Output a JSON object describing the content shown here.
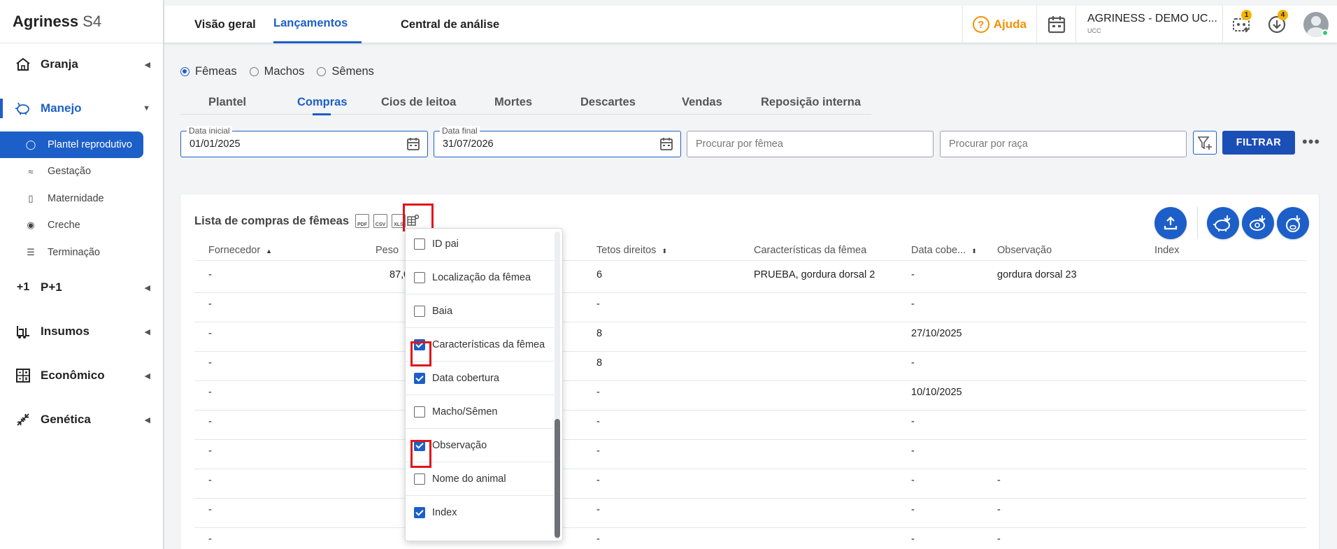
{
  "brand": {
    "name": "Agriness",
    "version": "S4"
  },
  "sidebar": {
    "groups": [
      {
        "label": "Granja",
        "icon": "home-icon"
      },
      {
        "label": "Manejo",
        "icon": "pig-icon"
      },
      {
        "label": "P+1",
        "icon": "plus-one-icon"
      },
      {
        "label": "Insumos",
        "icon": "forklift-icon"
      },
      {
        "label": "Econômico",
        "icon": "calculator-icon"
      },
      {
        "label": "Genética",
        "icon": "dna-icon"
      }
    ],
    "manejo_items": [
      {
        "label": "Plantel reprodutivo",
        "icon": "pig-icon"
      },
      {
        "label": "Gestação",
        "icon": "gestation-icon"
      },
      {
        "label": "Maternidade",
        "icon": "bottle-icon"
      },
      {
        "label": "Creche",
        "icon": "piglet-icon"
      },
      {
        "label": "Terminação",
        "icon": "feeder-icon"
      }
    ]
  },
  "topbar": {
    "tabs": [
      "Visão geral",
      "Lançamentos",
      "Central de análise"
    ],
    "active_tab": "Lançamentos",
    "help": "Ajuda",
    "company": "AGRINESS - DEMO UC...",
    "company_sub": "UCC",
    "badges": {
      "robot": "1",
      "download": "4"
    }
  },
  "radios": {
    "options": [
      "Fêmeas",
      "Machos",
      "Sêmens"
    ],
    "selected": "Fêmeas"
  },
  "subtabs": {
    "items": [
      "Plantel",
      "Compras",
      "Cios de leitoa",
      "Mortes",
      "Descartes",
      "Vendas",
      "Reposição interna"
    ],
    "active": "Compras"
  },
  "filters": {
    "date_start_label": "Data inicial",
    "date_start": "01/01/2025",
    "date_end_label": "Data final",
    "date_end": "31/07/2026",
    "search_female_placeholder": "Procurar por fêmea",
    "search_breed_placeholder": "Procurar por raça",
    "filter_button": "FILTRAR"
  },
  "list": {
    "title": "Lista de compras de fêmeas",
    "export_icons": [
      "PDF",
      "CSV",
      "XLS"
    ],
    "columns": [
      "Fornecedor",
      "Peso",
      "Tetos direitos",
      "Características da fêmea",
      "Data cobe...",
      "Observação",
      "Index"
    ],
    "rows": [
      {
        "fornecedor": "-",
        "peso": "87,0",
        "tetos": "6",
        "caracteristicas": "PRUEBA, gordura dorsal 2",
        "data": "-",
        "obs": "gordura dorsal 23"
      },
      {
        "fornecedor": "-",
        "peso": "",
        "tetos": "-",
        "caracteristicas": "",
        "data": "-",
        "obs": ""
      },
      {
        "fornecedor": "-",
        "peso": "",
        "tetos": "8",
        "caracteristicas": "",
        "data": "27/10/2025",
        "obs": ""
      },
      {
        "fornecedor": "-",
        "peso": "",
        "tetos": "8",
        "caracteristicas": "",
        "data": "-",
        "obs": ""
      },
      {
        "fornecedor": "-",
        "peso": "",
        "tetos": "-",
        "caracteristicas": "",
        "data": "10/10/2025",
        "obs": ""
      },
      {
        "fornecedor": "-",
        "peso": "",
        "tetos": "-",
        "caracteristicas": "",
        "data": "-",
        "obs": ""
      },
      {
        "fornecedor": "-",
        "peso": "",
        "tetos": "-",
        "caracteristicas": "",
        "data": "-",
        "obs": ""
      },
      {
        "fornecedor": "-",
        "peso": "",
        "tetos": "-",
        "caracteristicas": "",
        "data": "-",
        "obs": "-"
      },
      {
        "fornecedor": "-",
        "peso": "",
        "tetos": "-",
        "caracteristicas": "",
        "data": "-",
        "obs": "-"
      },
      {
        "fornecedor": "-",
        "peso": "",
        "tetos": "-",
        "caracteristicas": "",
        "data": "-",
        "obs": "-"
      }
    ]
  },
  "column_picker": {
    "options": [
      {
        "label": "ID pai",
        "checked": false
      },
      {
        "label": "Localização da fêmea",
        "checked": false
      },
      {
        "label": "Baia",
        "checked": false
      },
      {
        "label": "Características da fêmea",
        "checked": true
      },
      {
        "label": "Data cobertura",
        "checked": true
      },
      {
        "label": "Macho/Sêmen",
        "checked": false
      },
      {
        "label": "Observação",
        "checked": true
      },
      {
        "label": "Nome do animal",
        "checked": false
      },
      {
        "label": "Index",
        "checked": true
      }
    ]
  },
  "colors": {
    "primary": "#1d5fc8",
    "accent": "#f39200",
    "highlight": "#e0151b"
  }
}
